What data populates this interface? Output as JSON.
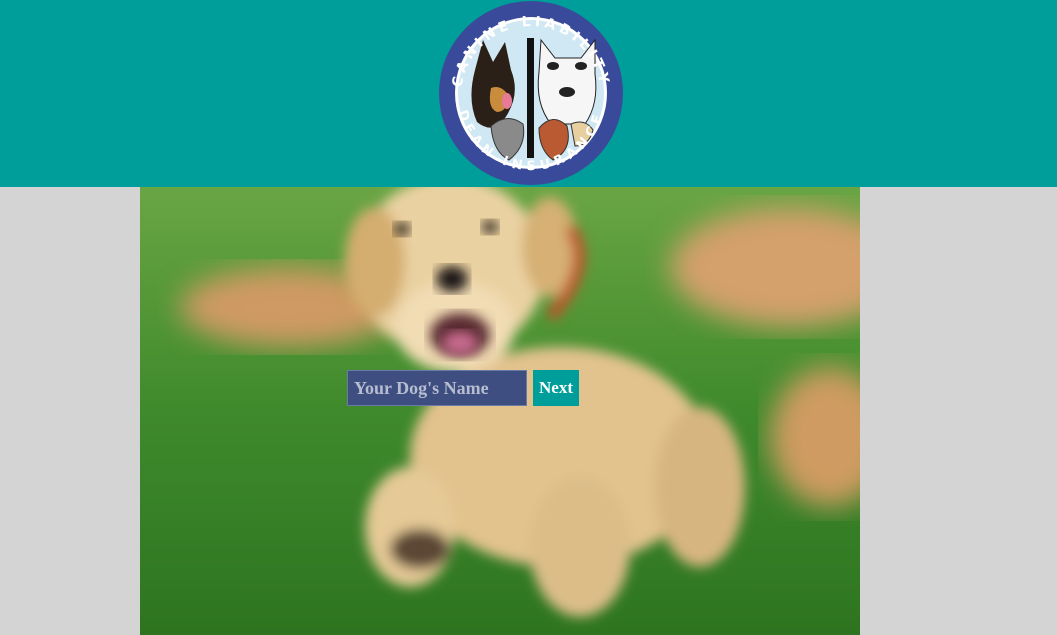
{
  "header": {
    "logo": {
      "top_text": "CANINE LIABILITY",
      "bottom_text": "DEAN INSURANCE",
      "ring_color": "#3a4a9a"
    },
    "background_color": "#009e9a"
  },
  "hero": {
    "image": "blurred golden retriever puppy running on grass"
  },
  "form": {
    "dog_name_placeholder": "Your Dog's Name",
    "dog_name_value": "",
    "next_label": "Next"
  },
  "colors": {
    "teal": "#009e9a",
    "input_bg": "#3e4e80",
    "page_bg": "#d4d4d4"
  }
}
